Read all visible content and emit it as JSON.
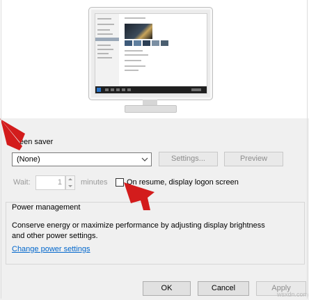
{
  "screen_saver": {
    "section_label": "een saver",
    "selected": "(None)",
    "settings_label": "Settings...",
    "preview_label": "Preview"
  },
  "wait": {
    "label": "Wait:",
    "value": "1",
    "unit": "minutes",
    "resume_label": "On resume, display logon screen",
    "resume_checked": false
  },
  "power": {
    "title": "Power management",
    "description": "Conserve energy or maximize performance by adjusting display brightness and other power settings.",
    "link": "Change power settings"
  },
  "footer": {
    "ok_label": "OK",
    "cancel_label": "Cancel",
    "apply_label": "Apply"
  },
  "watermark": "wsxdn.com",
  "colors": {
    "arrow": "#d31c1c",
    "link": "#0066cc",
    "button_bg": "#e1e1e1"
  }
}
